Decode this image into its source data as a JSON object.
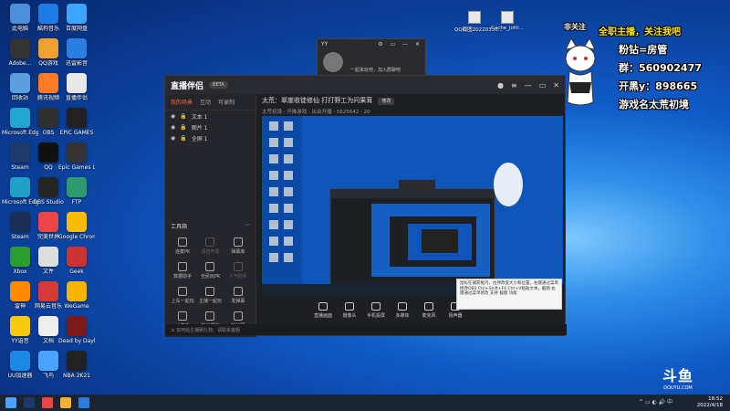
{
  "desktop_icons": [
    {
      "label": "此电脑",
      "color": "#4a90d9"
    },
    {
      "label": "酷狗音乐",
      "color": "#1c7be4"
    },
    {
      "label": "百度网盘",
      "color": "#3aa4ff"
    },
    {
      "label": "Adobe...",
      "color": "#333"
    },
    {
      "label": "QQ游戏",
      "color": "#f0a030"
    },
    {
      "label": "迅雷影音",
      "color": "#2a7fe0"
    },
    {
      "label": "回收站",
      "color": "#5aa0e0"
    },
    {
      "label": "腾讯视频",
      "color": "#ff7a22"
    },
    {
      "label": "直播伴侣",
      "color": "#e8e8e8"
    },
    {
      "label": "Microsoft Edge",
      "color": "#22a5d0"
    },
    {
      "label": "OBS",
      "color": "#303030"
    },
    {
      "label": "EPIC GAMES",
      "color": "#222"
    },
    {
      "label": "Steam",
      "color": "#1b3a6b"
    },
    {
      "label": "QQ",
      "color": "#111"
    },
    {
      "label": "Epic Games Launcher",
      "color": "#333"
    },
    {
      "label": "Microsoft Edge",
      "color": "#1fa0c8"
    },
    {
      "label": "OBS Studio",
      "color": "#252525"
    },
    {
      "label": "FTP",
      "color": "#2f9a6e"
    },
    {
      "label": "Steam",
      "color": "#1a2f55"
    },
    {
      "label": "完美世界",
      "color": "#e44"
    },
    {
      "label": "Google Chrome",
      "color": "#fbbc05"
    },
    {
      "label": "Xbox",
      "color": "#2a9d2a"
    },
    {
      "label": "文件",
      "color": "#ddd"
    },
    {
      "label": "Geek",
      "color": "#c33"
    },
    {
      "label": "雷神",
      "color": "#ff8c00"
    },
    {
      "label": "网易云音乐",
      "color": "#d43c33"
    },
    {
      "label": "WeGame",
      "color": "#f4b400"
    },
    {
      "label": "YY语音",
      "color": "#f6c90e"
    },
    {
      "label": "文档",
      "color": "#eee"
    },
    {
      "label": "Dead by Daylight",
      "color": "#7a1a1a"
    },
    {
      "label": "UU加速器",
      "color": "#1e88e5"
    },
    {
      "label": "飞鸟",
      "color": "#4aa3ff"
    },
    {
      "label": "NBA 2K21",
      "color": "#222"
    }
  ],
  "top_icons": [
    {
      "label": "QQ截图20220330..."
    },
    {
      "label": "Cache_jotti..."
    }
  ],
  "yy_window": {
    "title": "YY",
    "message": "一起来玩吧，加入群聊吧"
  },
  "app": {
    "logo": "直播伴侣",
    "version_badge": "BETA",
    "tabs": [
      "我的场景",
      "互动",
      "可录制"
    ],
    "scenes": [
      "文本 1",
      "图片 1",
      "全屏 1"
    ],
    "tools_title": "工具箱",
    "tool_items": [
      {
        "label": "连麦PK",
        "dim": false
      },
      {
        "label": "语音开黑",
        "dim": true
      },
      {
        "label": "弹幕库",
        "dim": false
      },
      {
        "label": "数据助手",
        "dim": false
      },
      {
        "label": "全民玩PK",
        "dim": false
      },
      {
        "label": "人气助手",
        "dim": true
      },
      {
        "label": "上车一起玩",
        "dim": false
      },
      {
        "label": "主播一起玩",
        "dim": false
      },
      {
        "label": "发弹幕",
        "dim": false
      },
      {
        "label": "小游戏",
        "dim": false
      },
      {
        "label": "粉丝福利",
        "dim": false
      },
      {
        "label": "粉丝团",
        "dim": false
      }
    ],
    "room_title": "太荒：翠崖收徒修仙 打打野工为问果茸",
    "room_tag": "修改",
    "room_meta": "太荒初境 · 开推游戏 · 出台开播 · 5625642 · 20",
    "controls": [
      "直播画面",
      "摄像头",
      "手机投屏",
      "多媒体",
      "麦克风",
      "扬声器"
    ],
    "tooltip": "鼠标在捕获框内，拉伸改变大小和位置，右键通过菜单修改OBS Ctrl+Shift+F6 Ctrl+V粘贴文本，截图 右键通过菜单修改 支持 截图 功能",
    "bottom_text": "如何给主播刷礼物、请联系客服"
  },
  "overlay": {
    "prefix": "非关注",
    "headline": "全职主播，关注我吧",
    "line2": "粉钻=房管",
    "line3": "群：560902477",
    "line4": "开黑y：898665",
    "line5": "游戏名太荒初境"
  },
  "watermark": {
    "brand": "斗鱼",
    "url": "DOUYU.COM"
  },
  "clock": {
    "time": "18:52",
    "date": "2022/4/18"
  }
}
